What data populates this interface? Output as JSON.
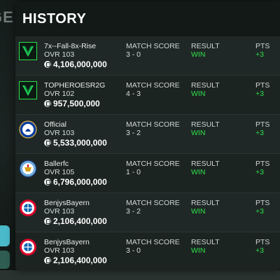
{
  "background": {
    "partial_title": "GE"
  },
  "modal": {
    "title": "HISTORY"
  },
  "columns": {
    "match_score": "MATCH SCORE",
    "result": "RESULT",
    "pts": "PTS"
  },
  "matches": [
    {
      "name": "7x--Fall-8x-Rise",
      "ovr": "OVR 103",
      "coins": "4,106,000,000",
      "crest": "green-v-badge",
      "score": "3 - 0",
      "result": "WIN",
      "pts": "+3"
    },
    {
      "name": "TOPHEROESR2G",
      "ovr": "OVR 102",
      "coins": "957,500,000",
      "crest": "green-v-badge",
      "score": "4 - 3",
      "result": "WIN",
      "pts": "+3"
    },
    {
      "name": "Official",
      "ovr": "OVR 103",
      "coins": "5,533,000,000",
      "crest": "chelsea-crest",
      "score": "3 - 2",
      "result": "WIN",
      "pts": "+3"
    },
    {
      "name": "Ballerfc",
      "ovr": "OVR 105",
      "coins": "6,796,000,000",
      "crest": "man-city-crest",
      "score": "1 - 0",
      "result": "WIN",
      "pts": "+3"
    },
    {
      "name": "BenjysBayern",
      "ovr": "OVR 103",
      "coins": "2,106,400,000",
      "crest": "bayern-crest",
      "score": "3 - 2",
      "result": "WIN",
      "pts": "+3"
    },
    {
      "name": "BenjysBayern",
      "ovr": "OVR 103",
      "coins": "2,106,400,000",
      "crest": "bayern-crest",
      "score": "3 - 0",
      "result": "WIN",
      "pts": "+3"
    }
  ],
  "colors": {
    "win": "#2fe04a",
    "modal_bg": "#1d2523",
    "header_bg": "#121917"
  }
}
